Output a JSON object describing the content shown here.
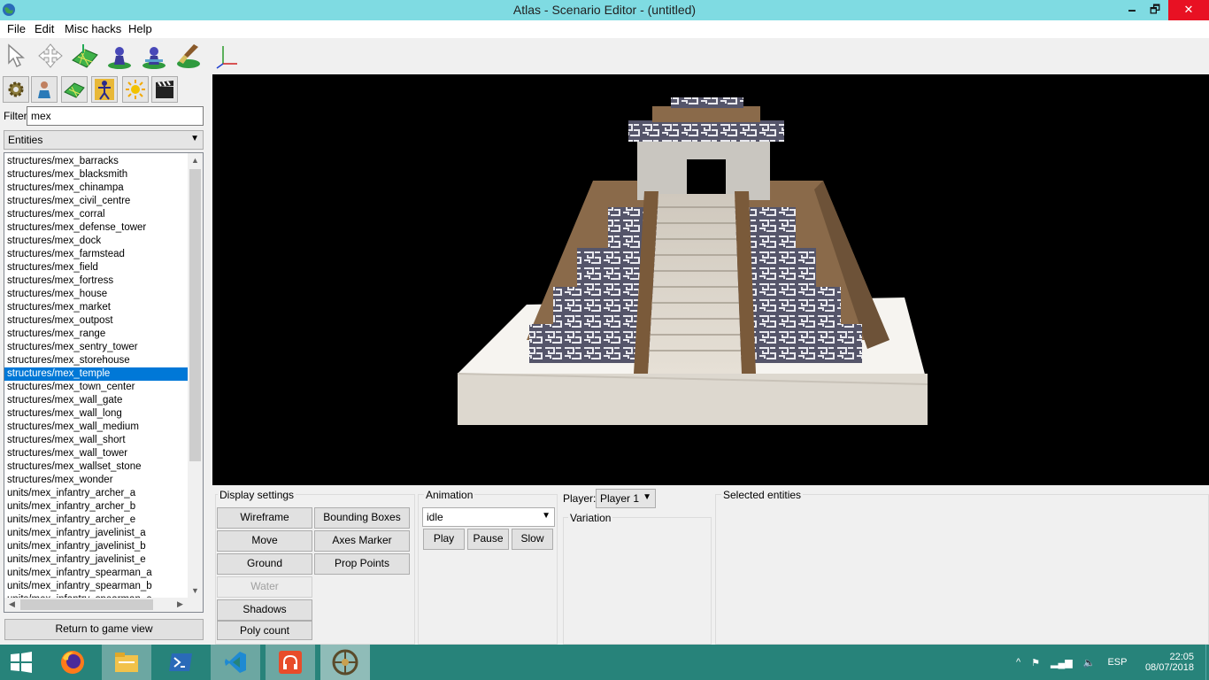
{
  "window": {
    "title": "Atlas - Scenario Editor - (untitled)",
    "minimize": "🗕",
    "maximize": "🗗",
    "close": "✕"
  },
  "menu": {
    "file": "File",
    "edit": "Edit",
    "misc": "Misc hacks",
    "help": "Help"
  },
  "toolbar": {
    "tools": [
      "select-arrow-icon",
      "move-cross-icon",
      "terrain-icon",
      "player-pawn-icon",
      "player-pawn-2-icon",
      "paint-brush-icon",
      "axes-icon"
    ],
    "panels": [
      "gear-icon",
      "person-icon",
      "terrain-tile-icon",
      "figure-icon",
      "sun-icon",
      "clapperboard-icon"
    ]
  },
  "filter": {
    "label": "Filter",
    "value": "mex"
  },
  "category_select": {
    "value": "Entities"
  },
  "entity_list": {
    "selected": "structures/mex_temple",
    "items": [
      "structures/mex_barracks",
      "structures/mex_blacksmith",
      "structures/mex_chinampa",
      "structures/mex_civil_centre",
      "structures/mex_corral",
      "structures/mex_defense_tower",
      "structures/mex_dock",
      "structures/mex_farmstead",
      "structures/mex_field",
      "structures/mex_fortress",
      "structures/mex_house",
      "structures/mex_market",
      "structures/mex_outpost",
      "structures/mex_range",
      "structures/mex_sentry_tower",
      "structures/mex_storehouse",
      "structures/mex_temple",
      "structures/mex_town_center",
      "structures/mex_wall_gate",
      "structures/mex_wall_long",
      "structures/mex_wall_medium",
      "structures/mex_wall_short",
      "structures/mex_wall_tower",
      "structures/mex_wallset_stone",
      "structures/mex_wonder",
      "units/mex_infantry_archer_a",
      "units/mex_infantry_archer_b",
      "units/mex_infantry_archer_e",
      "units/mex_infantry_javelinist_a",
      "units/mex_infantry_javelinist_b",
      "units/mex_infantry_javelinist_e",
      "units/mex_infantry_spearman_a",
      "units/mex_infantry_spearman_b",
      "units/mex_infantry_spearman_e"
    ]
  },
  "return_button": "Return to game view",
  "display_settings": {
    "title": "Display settings",
    "wireframe": "Wireframe",
    "bounding_boxes": "Bounding Boxes",
    "move": "Move",
    "axes_marker": "Axes Marker",
    "ground": "Ground",
    "prop_points": "Prop Points",
    "water": "Water",
    "shadows": "Shadows",
    "poly_count": "Poly count"
  },
  "animation": {
    "title": "Animation",
    "value": "idle",
    "play": "Play",
    "pause": "Pause",
    "slow": "Slow"
  },
  "player": {
    "label": "Player:",
    "value": "Player 1"
  },
  "variation": {
    "title": "Variation"
  },
  "selected_entities": {
    "title": "Selected entities"
  },
  "taskbar": {
    "apps": [
      "windows-start-icon",
      "firefox-icon",
      "file-explorer-icon",
      "powershell-icon",
      "vscode-icon",
      "headphones-app-icon",
      "atlas-editor-icon"
    ],
    "lang": "ESP",
    "time": "22:05",
    "date": "08/07/2018"
  }
}
